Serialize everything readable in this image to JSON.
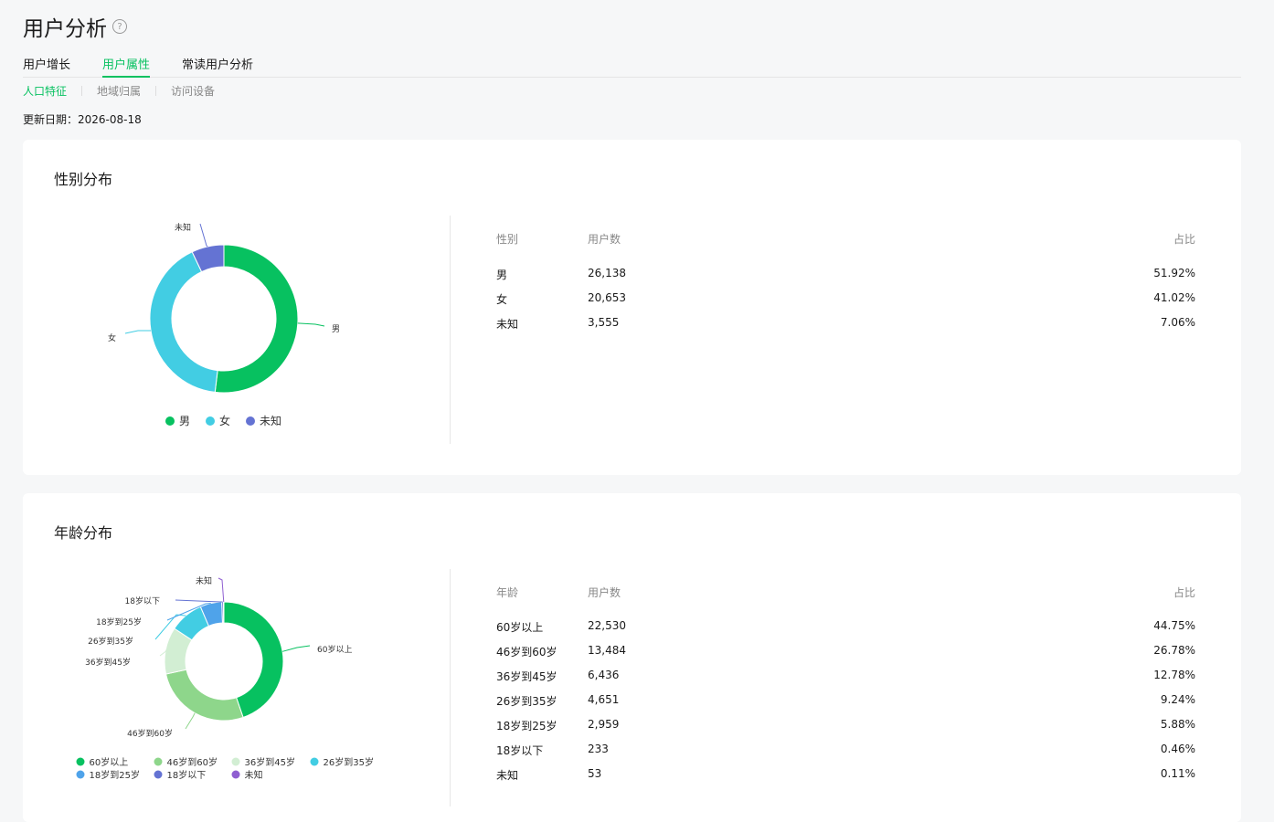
{
  "header": {
    "title": "用户分析",
    "help_icon": "question-circle-icon"
  },
  "tabs": [
    {
      "label": "用户增长",
      "active": false
    },
    {
      "label": "用户属性",
      "active": true
    },
    {
      "label": "常读用户分析",
      "active": false
    }
  ],
  "subtabs": [
    {
      "label": "人口特征",
      "active": true
    },
    {
      "label": "地域归属",
      "active": false
    },
    {
      "label": "访问设备",
      "active": false
    }
  ],
  "update": {
    "label": "更新日期：",
    "date": "2026-08-18"
  },
  "gender": {
    "title": "性别分布",
    "columns": [
      "性别",
      "用户数",
      "占比"
    ],
    "rows": [
      {
        "name": "男",
        "count": "26,138",
        "pct": "51.92%"
      },
      {
        "name": "女",
        "count": "20,653",
        "pct": "41.02%"
      },
      {
        "name": "未知",
        "count": "3,555",
        "pct": "7.06%"
      }
    ]
  },
  "age": {
    "title": "年龄分布",
    "columns": [
      "年龄",
      "用户数",
      "占比"
    ],
    "rows": [
      {
        "name": "60岁以上",
        "count": "22,530",
        "pct": "44.75%"
      },
      {
        "name": "46岁到60岁",
        "count": "13,484",
        "pct": "26.78%"
      },
      {
        "name": "36岁到45岁",
        "count": "6,436",
        "pct": "12.78%"
      },
      {
        "name": "26岁到35岁",
        "count": "4,651",
        "pct": "9.24%"
      },
      {
        "name": "18岁到25岁",
        "count": "2,959",
        "pct": "5.88%"
      },
      {
        "name": "18岁以下",
        "count": "233",
        "pct": "0.46%"
      },
      {
        "name": "未知",
        "count": "53",
        "pct": "0.11%"
      }
    ]
  },
  "chart_data": [
    {
      "type": "pie",
      "categories": [
        "男",
        "女",
        "未知"
      ],
      "values": [
        51.92,
        41.02,
        7.06
      ],
      "colors": [
        "#07c160",
        "#42cde3",
        "#6473d3"
      ],
      "legend": "bottom"
    },
    {
      "type": "pie",
      "categories": [
        "60岁以上",
        "46岁到60岁",
        "36岁到45岁",
        "26岁到35岁",
        "18岁到25岁",
        "18岁以下",
        "未知"
      ],
      "values": [
        44.75,
        26.78,
        12.78,
        9.24,
        5.88,
        0.46,
        0.11
      ],
      "colors": [
        "#07c160",
        "#8ed68b",
        "#d2eed3",
        "#42cde3",
        "#4fa3ea",
        "#6473d3",
        "#8f5fd1"
      ],
      "legend": "bottom"
    }
  ]
}
